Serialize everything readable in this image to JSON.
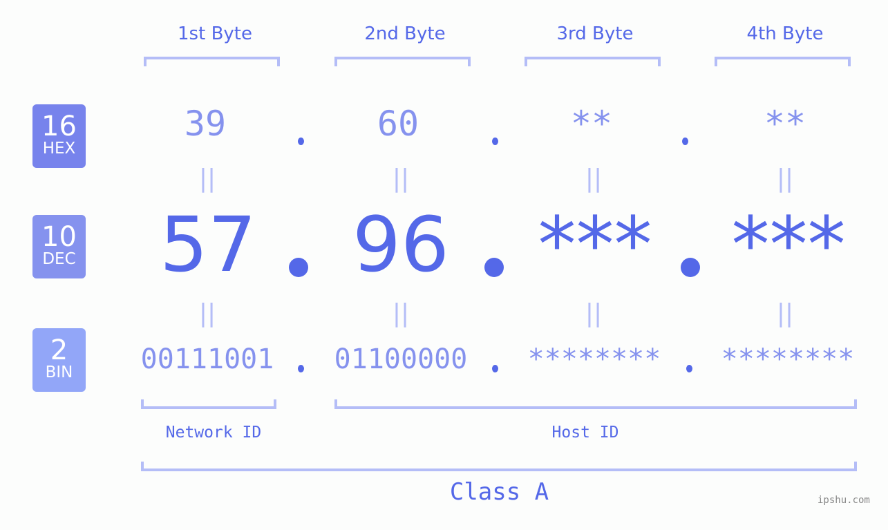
{
  "byte_headers": [
    "1st Byte",
    "2nd Byte",
    "3rd Byte",
    "4th Byte"
  ],
  "badges": {
    "hex": {
      "number": "16",
      "label": "HEX",
      "color": "#7783ec"
    },
    "dec": {
      "number": "10",
      "label": "DEC",
      "color": "#8592ee"
    },
    "bin": {
      "number": "2",
      "label": "BIN",
      "color": "#92a6f8"
    }
  },
  "hex_values": [
    "39",
    "60",
    "**",
    "**"
  ],
  "dec_values": [
    "57",
    "96",
    "***",
    "***"
  ],
  "bin_values": [
    "00111001",
    "01100000",
    "********",
    "********"
  ],
  "equals_symbol": "||",
  "network_id_label": "Network ID",
  "host_id_label": "Host ID",
  "class_label": "Class A",
  "watermark": "ipshu.com",
  "colors": {
    "accent": "#5468e8",
    "muted": "#8592ee",
    "bracket": "#b4bdf7",
    "background": "#fcfdfc"
  }
}
